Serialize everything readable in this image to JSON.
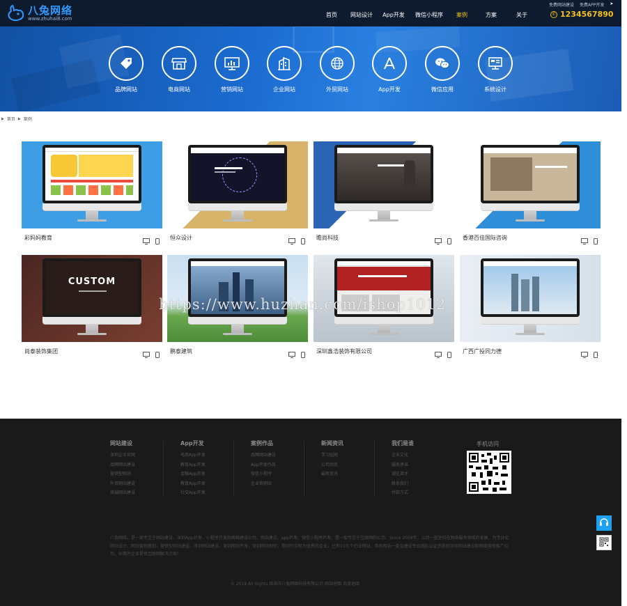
{
  "header": {
    "logo_text": "八兔网络",
    "logo_url": "www.zhuhai8.com",
    "nav": [
      {
        "label": "首页",
        "active": false
      },
      {
        "label": "网站设计",
        "active": false
      },
      {
        "label": "App开发",
        "active": false
      },
      {
        "label": "微信小程序",
        "active": false
      },
      {
        "label": "案例",
        "active": true
      },
      {
        "label": "方案",
        "active": false
      },
      {
        "label": "关于",
        "active": false
      }
    ],
    "top_links": [
      "免费网站建设",
      "免费APP开发"
    ],
    "phone": "1234567890"
  },
  "banner": {
    "categories": [
      {
        "label": "品牌网站",
        "icon": "tag-icon"
      },
      {
        "label": "电商网站",
        "icon": "store-icon"
      },
      {
        "label": "营销网站",
        "icon": "chart-icon"
      },
      {
        "label": "企业网站",
        "icon": "building-icon"
      },
      {
        "label": "外贸网站",
        "icon": "globe-icon"
      },
      {
        "label": "App开发",
        "icon": "app-store-icon"
      },
      {
        "label": "微信应用",
        "icon": "wechat-icon"
      },
      {
        "label": "系统设计",
        "icon": "system-icon"
      }
    ]
  },
  "breadcrumb": {
    "home": "首页",
    "current": "案例"
  },
  "cases": [
    {
      "title": "彩妈妈教育"
    },
    {
      "title": "恒众设计"
    },
    {
      "title": "瞻尚科技"
    },
    {
      "title": "香港百佳国际咨询"
    },
    {
      "title": "尚泰装饰集团"
    },
    {
      "title": "鹏泰建筑"
    },
    {
      "title": "深圳鑫浩装饰有限公司"
    },
    {
      "title": "广西广投同力德"
    }
  ],
  "case_screens": {
    "custom_text": "CUSTOM"
  },
  "footer": {
    "columns": [
      {
        "title": "网站建设",
        "items": [
          "深圳企业官网",
          "品牌网站建设",
          "营销型网站",
          "外贸网站建设",
          "商城网站建设"
        ]
      },
      {
        "title": "App开发",
        "items": [
          "电商App开发",
          "教育App开发",
          "金融App开发",
          "教育App开发",
          "社交App开发"
        ]
      },
      {
        "title": "案例作品",
        "items": [
          "品牌网站建设",
          "App开发作品",
          "微信小程序",
          "企业官网站"
        ]
      },
      {
        "title": "新闻资讯",
        "items": [
          "学习园地",
          "公司动态",
          "最新资讯"
        ]
      },
      {
        "title": "我们是谁",
        "items": [
          "企业文化",
          "服务承诺",
          "诚征英才",
          "联系我们",
          "付款方式"
        ]
      }
    ],
    "qr_title": "手机访问",
    "description": "八兔网络，是一家专注于网站建设、深圳App开发、小程序开发的网络建设公司，网站建设，app开发，微信小程序开发，是一家专注于互联网的公司。Since 2009年，公司一直坚持在网络服务领域的发展，为专业化网站设计、网站营销策划，营销型网站建设，深圳网站建设、深圳网站开发，深圳网站制作，是同行中较为优秀的企业，已有10几个行业网站，具有网站一条龙建设专业团队认证资质的深圳网站建设和网络营销推广公司，长期为企业提供互联网解决方案！",
    "copyright": "© 2018 All Rights 珠海市八兔网络科技有限公司    网站地图    百度地图"
  },
  "watermark": "https://www.huzhan.com/ishop1012"
}
